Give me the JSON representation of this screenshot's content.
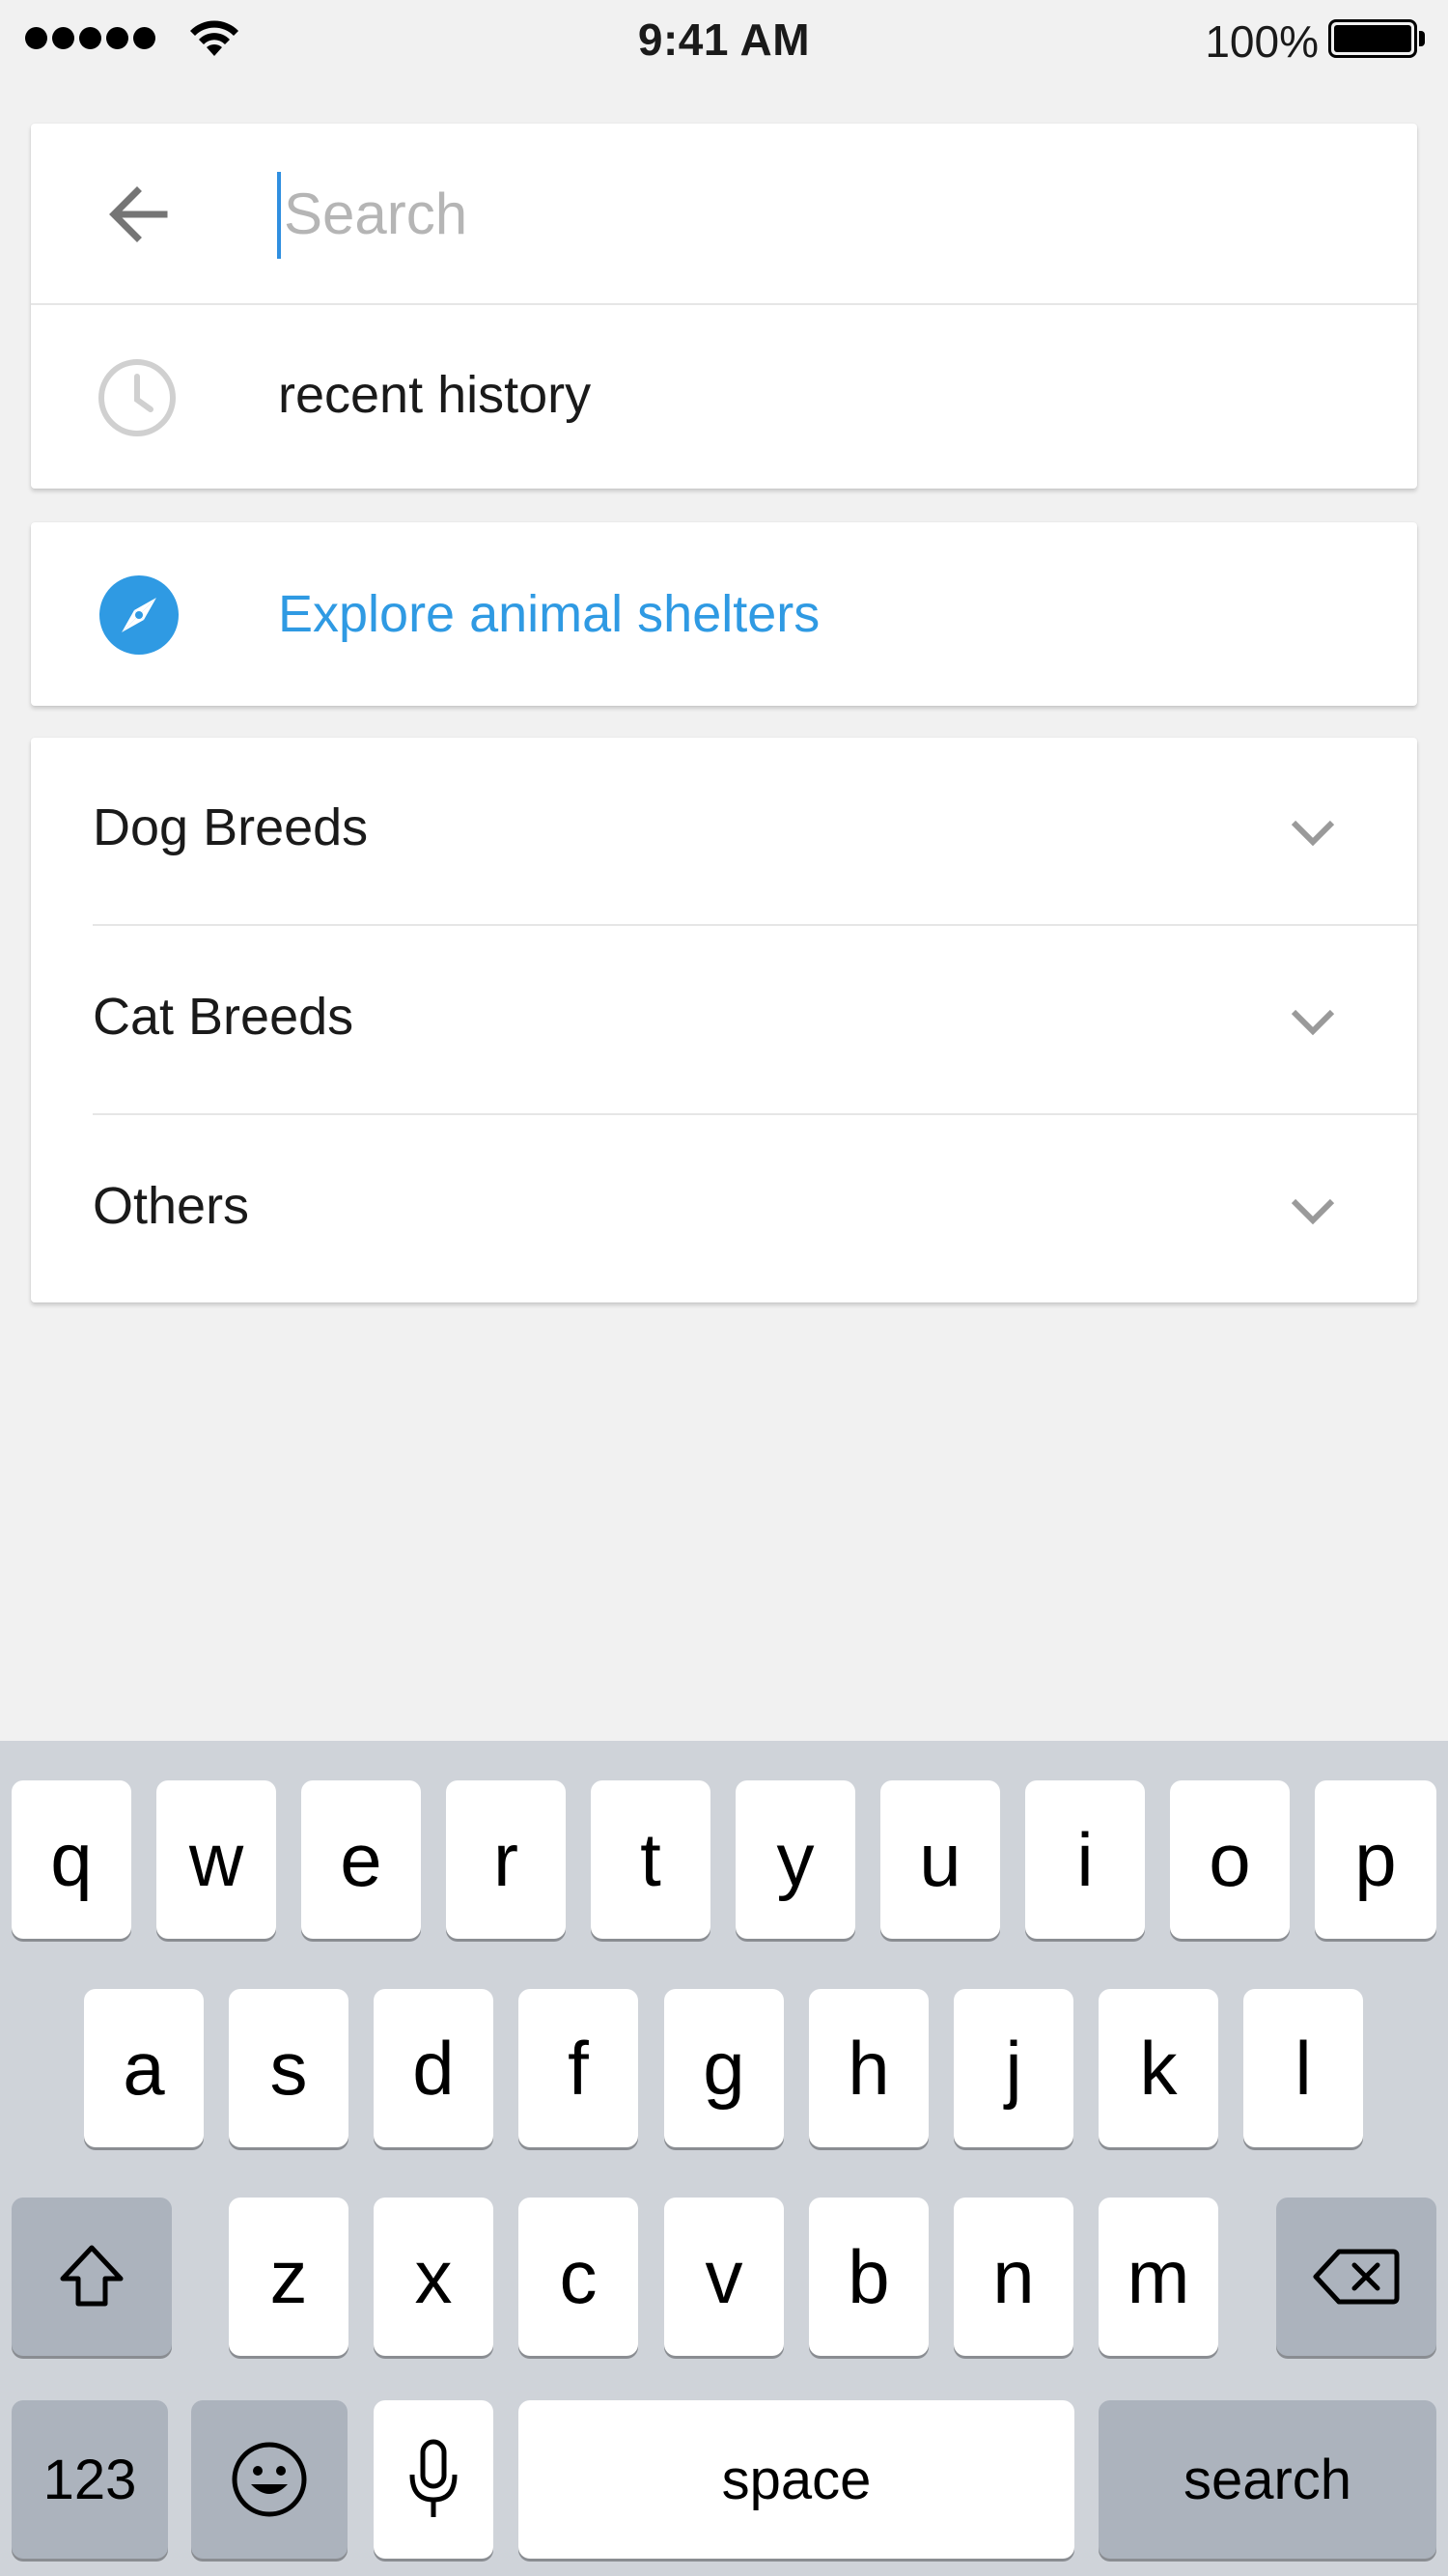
{
  "status_bar": {
    "time": "9:41 AM",
    "battery_percent": "100%",
    "battery_level": 1.0,
    "signal_bars": 5,
    "wifi_icon": "wifi-icon",
    "battery_icon": "battery-icon"
  },
  "search": {
    "placeholder": "Search",
    "value": "",
    "back_icon": "arrow-left-icon"
  },
  "history": {
    "label": "recent history",
    "icon": "clock-icon"
  },
  "explore": {
    "label": "Explore animal shelters",
    "icon": "compass-icon",
    "color": "#2f9ae3"
  },
  "categories": [
    {
      "label": "Dog Breeds",
      "icon": "chevron-down-icon"
    },
    {
      "label": "Cat Breeds",
      "icon": "chevron-down-icon"
    },
    {
      "label": "Others",
      "icon": "chevron-down-icon"
    }
  ],
  "keyboard": {
    "row1": [
      "q",
      "w",
      "e",
      "r",
      "t",
      "y",
      "u",
      "i",
      "o",
      "p"
    ],
    "row2": [
      "a",
      "s",
      "d",
      "f",
      "g",
      "h",
      "j",
      "k",
      "l"
    ],
    "row3": [
      "z",
      "x",
      "c",
      "v",
      "b",
      "n",
      "m"
    ],
    "shift_icon": "shift-icon",
    "delete_icon": "backspace-icon",
    "numbers_label": "123",
    "emoji_icon": "emoji-icon",
    "mic_icon": "microphone-icon",
    "space_label": "space",
    "search_label": "search"
  },
  "colors": {
    "background": "#f1f1f1",
    "accent": "#2f9ae3",
    "keyboard_bg": "#cfd3d9",
    "function_key": "#acb3bd"
  }
}
